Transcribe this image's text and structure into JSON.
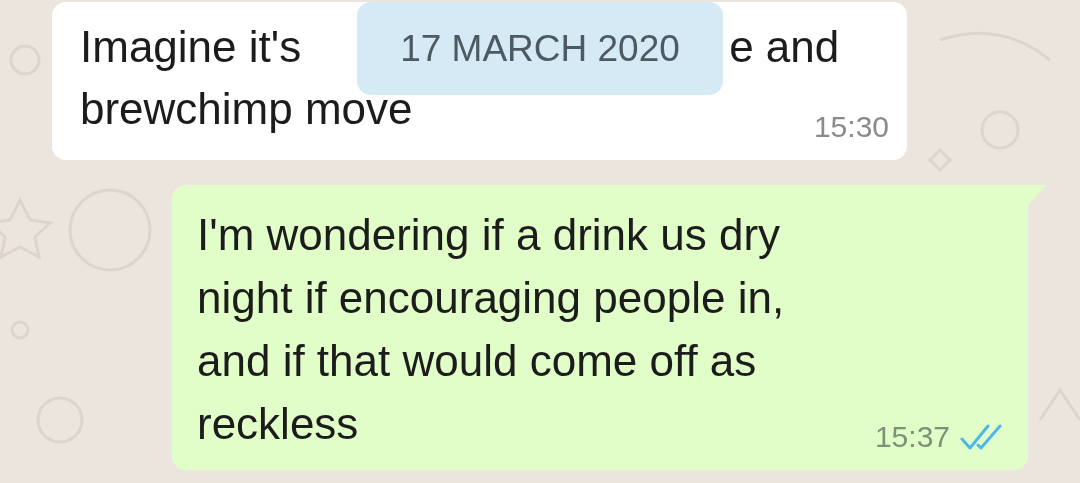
{
  "date_chip": "17 MARCH 2020",
  "messages": [
    {
      "kind": "incoming",
      "line_1_start": "Imagine it's",
      "line_1_end": "e and",
      "lines": [
        "brewchimp move"
      ],
      "time": "15:30"
    },
    {
      "kind": "outgoing",
      "lines": [
        "I'm wondering if a drink us dry",
        "night if encouraging people in,",
        "and if that would come off as",
        "reckless"
      ],
      "time": "15:37",
      "read": true
    }
  ]
}
